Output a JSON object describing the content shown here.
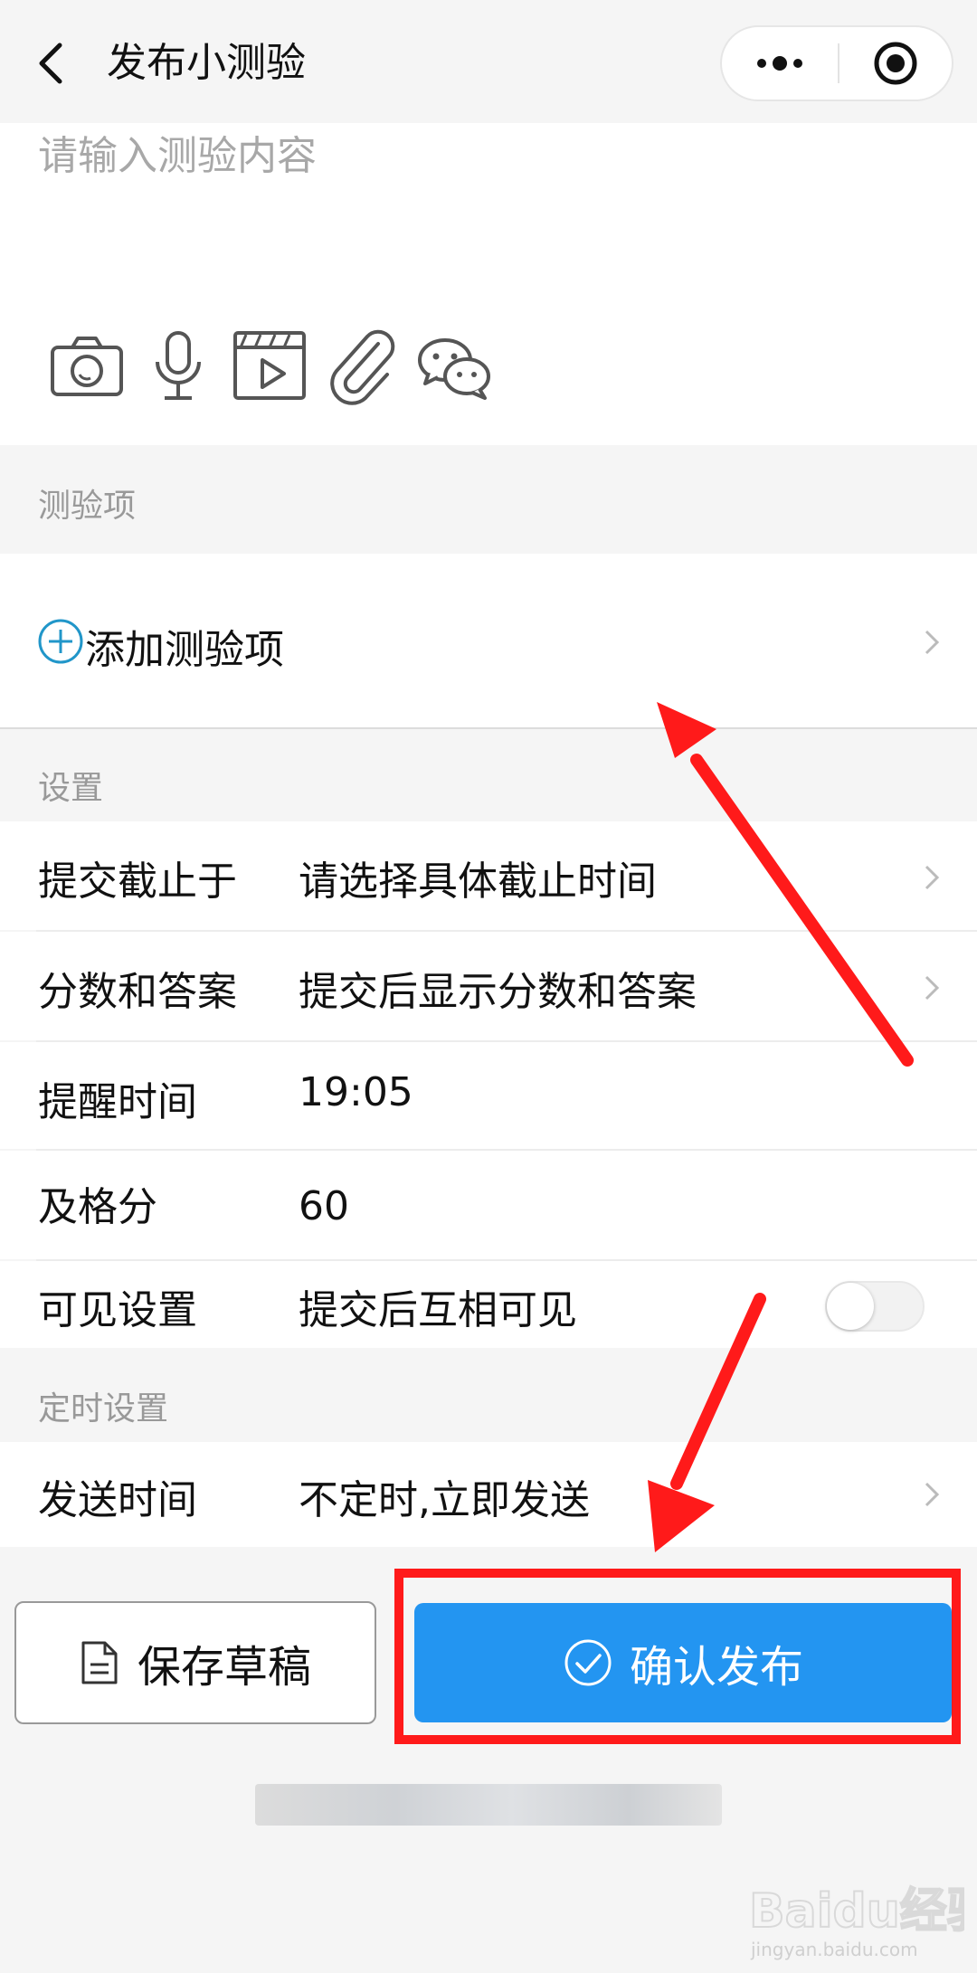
{
  "header": {
    "title": "发布小测验",
    "back_icon": "chevron-left-icon",
    "more_icon": "more-dots-icon",
    "close_icon": "target-close-icon"
  },
  "content": {
    "placeholder": "请输入测验内容",
    "value": "",
    "tools": [
      "camera-icon",
      "microphone-icon",
      "video-icon",
      "attachment-icon",
      "wechat-icon"
    ]
  },
  "quiz_items": {
    "section_label": "测验项",
    "add_label": "添加测验项",
    "accent_color": "#2196c9"
  },
  "settings": {
    "section_label": "设置",
    "rows": [
      {
        "label": "提交截止于",
        "value": "请选择具体截止时间"
      },
      {
        "label": "分数和答案",
        "value": "提交后显示分数和答案"
      },
      {
        "label": "提醒时间",
        "value": "19:05"
      },
      {
        "label": "及格分",
        "value": "60"
      },
      {
        "label": "可见设置",
        "value": "提交后互相可见",
        "toggle_on": false
      }
    ]
  },
  "timing": {
    "section_label": "定时设置",
    "row": {
      "label": "发送时间",
      "value": "不定时,立即发送"
    }
  },
  "actions": {
    "save_label": "保存草稿",
    "confirm_label": "确认发布",
    "confirm_color": "#2395f1",
    "highlight_color": "#ff1a1a"
  },
  "watermark": {
    "text": "Baidu经验",
    "sub": "jingyan.baidu.com"
  }
}
